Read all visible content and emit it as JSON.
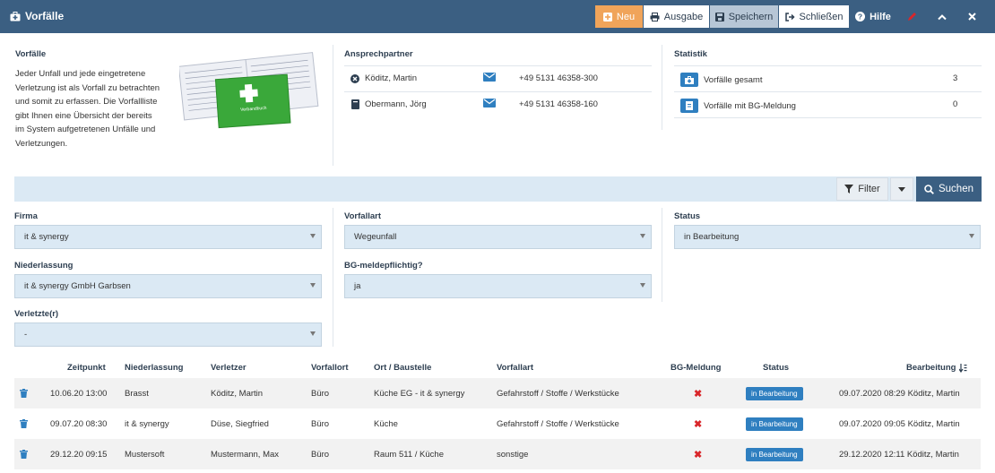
{
  "window": {
    "title": "Vorfälle"
  },
  "toolbar": {
    "new_label": "Neu",
    "output_label": "Ausgabe",
    "save_label": "Speichern",
    "close_label": "Schließen",
    "help_label": "Hilfe"
  },
  "intro": {
    "title": "Vorfälle",
    "text": "Jeder Unfall und jede eingetretene Verletzung ist als Vorfall zu betrachten und somit zu erfassen. Die Vorfallliste gibt Ihnen eine Übersicht der bereits im System aufgetretenen Unfälle und Verletzungen.",
    "image_text": "Verbandbuch"
  },
  "contacts": {
    "title": "Ansprechpartner",
    "items": [
      {
        "name": "Köditz, Martin",
        "phone": "+49 5131 46358-300"
      },
      {
        "name": "Obermann, Jörg",
        "phone": "+49 5131 46358-160"
      }
    ]
  },
  "stats": {
    "title": "Statistik",
    "items": [
      {
        "label": "Vorfälle gesamt",
        "value": "3"
      },
      {
        "label": "Vorfälle mit BG-Meldung",
        "value": "0"
      }
    ]
  },
  "filter": {
    "filter_label": "Filter",
    "search_label": "Suchen",
    "fields": {
      "firma": {
        "label": "Firma",
        "value": "it & synergy"
      },
      "niederlassung": {
        "label": "Niederlassung",
        "value": "it & synergy GmbH Garbsen"
      },
      "verletzte": {
        "label": "Verletzte(r)",
        "value": "-"
      },
      "vorfallart": {
        "label": "Vorfallart",
        "value": "Wegeunfall"
      },
      "bg": {
        "label": "BG-meldepflichtig?",
        "value": "ja"
      },
      "status": {
        "label": "Status",
        "value": "in Bearbeitung"
      }
    }
  },
  "table": {
    "headers": {
      "zeitpunkt": "Zeitpunkt",
      "niederlassung": "Niederlassung",
      "verletzer": "Verletzer",
      "vorfallort": "Vorfallort",
      "ort": "Ort / Baustelle",
      "vorfallart": "Vorfallart",
      "bg": "BG-Meldung",
      "status": "Status",
      "bearbeitung": "Bearbeitung"
    },
    "rows": [
      {
        "zeitpunkt": "10.06.20 13:00",
        "niederlassung": "Brasst",
        "verletzer": "Köditz, Martin",
        "vorfallort": "Büro",
        "ort": "Küche EG - it & synergy",
        "vorfallart": "Gefahrstoff / Stoffe / Werkstücke",
        "bg": "✖",
        "status": "in Bearbeitung",
        "bearbeitung": "09.07.2020 08:29 Köditz, Martin"
      },
      {
        "zeitpunkt": "09.07.20 08:30",
        "niederlassung": "it & synergy",
        "verletzer": "Düse, Siegfried",
        "vorfallort": "Büro",
        "ort": "Küche",
        "vorfallart": "Gefahrstoff / Stoffe / Werkstücke",
        "bg": "✖",
        "status": "in Bearbeitung",
        "bearbeitung": "09.07.2020 09:05 Köditz, Martin"
      },
      {
        "zeitpunkt": "29.12.20 09:15",
        "niederlassung": "Mustersoft",
        "verletzer": "Mustermann, Max",
        "vorfallort": "Büro",
        "ort": "Raum 511 / Küche",
        "vorfallart": "sonstige",
        "bg": "✖",
        "status": "in Bearbeitung",
        "bearbeitung": "29.12.2020 12:11 Köditz, Martin"
      }
    ]
  },
  "colors": {
    "header": "#3b5f82",
    "accent": "#2f7fc0",
    "new": "#f0a45a",
    "danger": "#d9262a"
  }
}
